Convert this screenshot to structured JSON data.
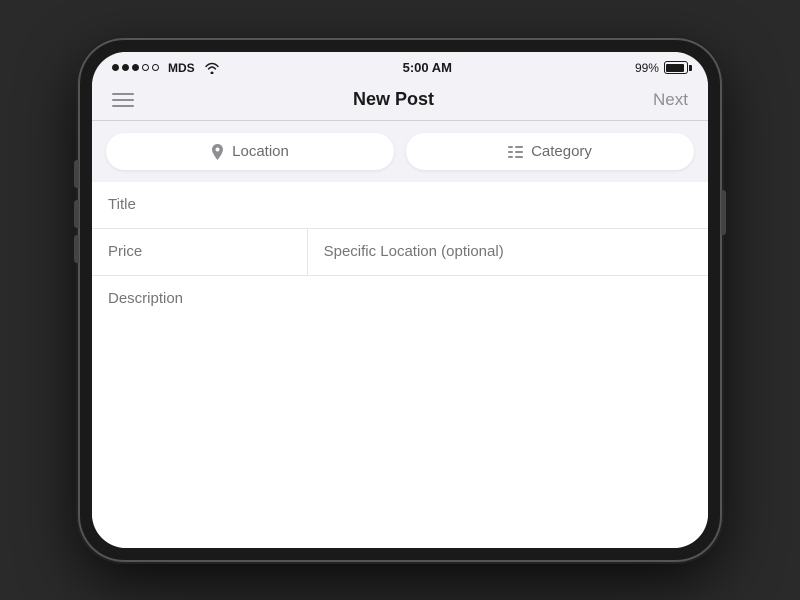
{
  "statusBar": {
    "carrier": "MDS",
    "time": "5:00 AM",
    "batteryPct": "99%"
  },
  "navBar": {
    "title": "New Post",
    "nextLabel": "Next"
  },
  "filters": {
    "locationLabel": "Location",
    "categoryLabel": "Category"
  },
  "form": {
    "titlePlaceholder": "Title",
    "pricePlaceholder": "Price",
    "specificLocationPlaceholder": "Specific Location (optional)",
    "descriptionPlaceholder": "Description"
  }
}
